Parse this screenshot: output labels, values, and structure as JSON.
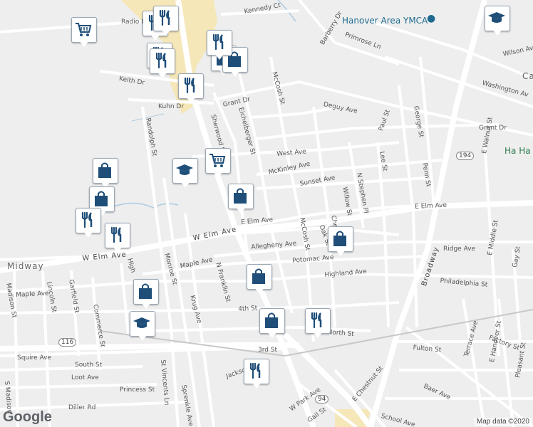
{
  "map": {
    "provider_logo": "Google",
    "attribution": "Map data ©2020",
    "colors": {
      "background": "#eeeeee",
      "road": "#ffffff",
      "major_road": "#ffffff",
      "water": "#aecbe0",
      "highlight": "#f6e6b0",
      "marker_icon": "#1f4e79",
      "park_poi": "#2e7d4f",
      "ymca_poi": "#1e6b8f"
    }
  },
  "places": [
    {
      "name": "Hanover Area YMCA",
      "type": "poi"
    },
    {
      "name": "Midway",
      "type": "area"
    },
    {
      "name": "Ha Ha",
      "type": "park"
    },
    {
      "name": "Ca",
      "type": "area"
    }
  ],
  "streets": [
    "Radio R",
    "Kennedy Ct",
    "Barberry Dr",
    "Primrose Ln",
    "Wilson Ave",
    "Washington Av",
    "Keith Dr",
    "Kuhn Dr",
    "Grant Dr",
    "Deguy Ave",
    "Grant Dr",
    "McCosh St",
    "Eichelberger St",
    "Sherwood St",
    "Randolph St",
    "West Ave",
    "McKinley Ave",
    "Sunset Ave",
    "Paul St",
    "George St",
    "Penn St",
    "Lee St",
    "N Stephen Pl",
    "Willow St",
    "E Walnut St",
    "E Elm Ave",
    "E Elm Ave",
    "W Elm Ave",
    "W Elm Ave",
    "Allegheny Ave",
    "Ridge Ave",
    "Maple Ave",
    "Potomac Ave",
    "McCosh St",
    "Highland Ave",
    "Philadelphia St",
    "Monroe St",
    "N Franklin St",
    "Krug Ave",
    "High",
    "Maple Ave",
    "Garfield St",
    "Lincoln St",
    "Madison St",
    "Commerce St",
    "4th St",
    "North St",
    "Broadway",
    "E Middle St",
    "Gay St",
    "Squire Ave",
    "South St",
    "3rd St",
    "Fulton St",
    "Factory St",
    "Loot Ave",
    "St Vincents Ln",
    "E Chestnut St",
    "Terrace Ave",
    "E Hanover St",
    "Princess St",
    "Jackson",
    "Sprenkle Ave",
    "Baer Ave",
    "Pleasant St",
    "Diller Rd",
    "W Park Ave",
    "Gail St",
    "School Ave",
    "S Madison",
    "Oak St",
    "Chestnut"
  ],
  "route_shields": [
    "194",
    "116",
    "94"
  ],
  "markers": [
    {
      "icon": "restaurant-icon"
    },
    {
      "icon": "restaurant-icon"
    },
    {
      "icon": "shopping-cart-icon"
    },
    {
      "icon": "restaurant-icon"
    },
    {
      "icon": "restaurant-icon"
    },
    {
      "icon": "shopping-bag-icon"
    },
    {
      "icon": "shopping-bag-icon"
    },
    {
      "icon": "restaurant-icon"
    },
    {
      "icon": "graduation-cap-icon"
    },
    {
      "icon": "graduation-cap-icon"
    },
    {
      "icon": "restaurant-icon"
    },
    {
      "icon": "shopping-cart-icon"
    },
    {
      "icon": "shopping-bag-icon"
    },
    {
      "icon": "shopping-bag-icon"
    },
    {
      "icon": "shopping-bag-icon"
    },
    {
      "icon": "restaurant-icon"
    },
    {
      "icon": "restaurant-icon"
    },
    {
      "icon": "shopping-bag-icon"
    },
    {
      "icon": "shopping-bag-icon"
    },
    {
      "icon": "shopping-bag-icon"
    },
    {
      "icon": "graduation-cap-icon"
    },
    {
      "icon": "shopping-bag-icon"
    },
    {
      "icon": "restaurant-icon"
    },
    {
      "icon": "restaurant-icon"
    }
  ]
}
